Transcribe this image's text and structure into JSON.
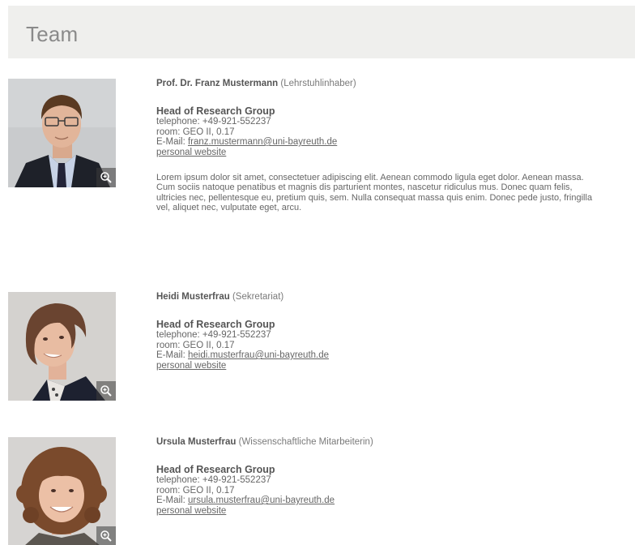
{
  "header": {
    "title": "Team"
  },
  "members": [
    {
      "name": "Prof. Dr. Franz Mustermann",
      "role": "(Lehrstuhlinhaber)",
      "position": "Head of Research Group",
      "phone": "telephone: +49-921-552237",
      "room": "room: GEO II, 0.17",
      "email_label": "E-Mail:",
      "email": "franz.mustermann@uni-bayreuth.de",
      "website": "personal website",
      "bio": "Lorem ipsum dolor sit amet, consectetuer adipiscing elit. Aenean commodo ligula eget dolor. Aenean massa. Cum sociis natoque penatibus et magnis dis parturient montes, nascetur ridiculus mus. Donec quam felis, ultricies nec, pellentesque eu, pretium quis, sem. Nulla consequat massa quis enim. Donec pede justo, fringilla vel, aliquet nec, vulputate eget, arcu."
    },
    {
      "name": "Heidi Musterfrau",
      "role": "(Sekretariat)",
      "position": "Head of Research Group",
      "phone": "telephone: +49-921-552237",
      "room": "room: GEO II, 0.17",
      "email_label": "E-Mail:",
      "email": "heidi.musterfrau@uni-bayreuth.de",
      "website": "personal website"
    },
    {
      "name": "Ursula Musterfrau",
      "role": "(Wissenschaftliche Mitarbeiterin)",
      "position": "Head of Research Group",
      "phone": "telephone: +49-921-552237",
      "room": "room: GEO II, 0.17",
      "email_label": "E-Mail:",
      "email": "ursula.musterfrau@uni-bayreuth.de",
      "website": "personal website"
    }
  ],
  "icons": {
    "zoom": "zoom-in-icon"
  },
  "colors": {
    "header_bg": "#efefed",
    "title": "#8a8a8a",
    "text": "#666666"
  }
}
